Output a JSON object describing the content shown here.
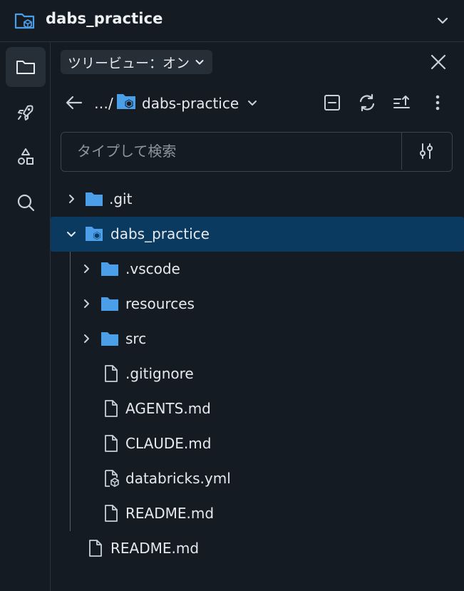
{
  "window": {
    "title": "dabs_practice"
  },
  "rail": {
    "items": [
      {
        "icon": "folder-icon",
        "active": true
      },
      {
        "icon": "rocket-icon",
        "active": false
      },
      {
        "icon": "shapes-icon",
        "active": false
      },
      {
        "icon": "search-icon",
        "active": false
      }
    ]
  },
  "panel": {
    "view_toggle": "ツリービュー：オン",
    "breadcrumb": {
      "ellipsis": "…/",
      "current": "dabs-practice"
    },
    "search": {
      "placeholder": "タイプして検索",
      "value": ""
    }
  },
  "tree": {
    "items": [
      {
        "label": ".git",
        "type": "folder",
        "expanded": false
      },
      {
        "label": "dabs_practice",
        "type": "bundle-folder",
        "expanded": true,
        "selected": true
      },
      {
        "label": ".vscode",
        "type": "folder",
        "expanded": false
      },
      {
        "label": "resources",
        "type": "folder",
        "expanded": false
      },
      {
        "label": "src",
        "type": "folder",
        "expanded": false
      },
      {
        "label": ".gitignore",
        "type": "file"
      },
      {
        "label": "AGENTS.md",
        "type": "file"
      },
      {
        "label": "CLAUDE.md",
        "type": "file"
      },
      {
        "label": "databricks.yml",
        "type": "bundle-file"
      },
      {
        "label": "README.md",
        "type": "file"
      },
      {
        "label": "README.md",
        "type": "file"
      }
    ]
  },
  "colors": {
    "background": "#151b23",
    "selected_row": "#0b3a61",
    "folder_blue": "#4a9fe8",
    "text": "#e6e9ed",
    "placeholder": "#8d96a0"
  }
}
